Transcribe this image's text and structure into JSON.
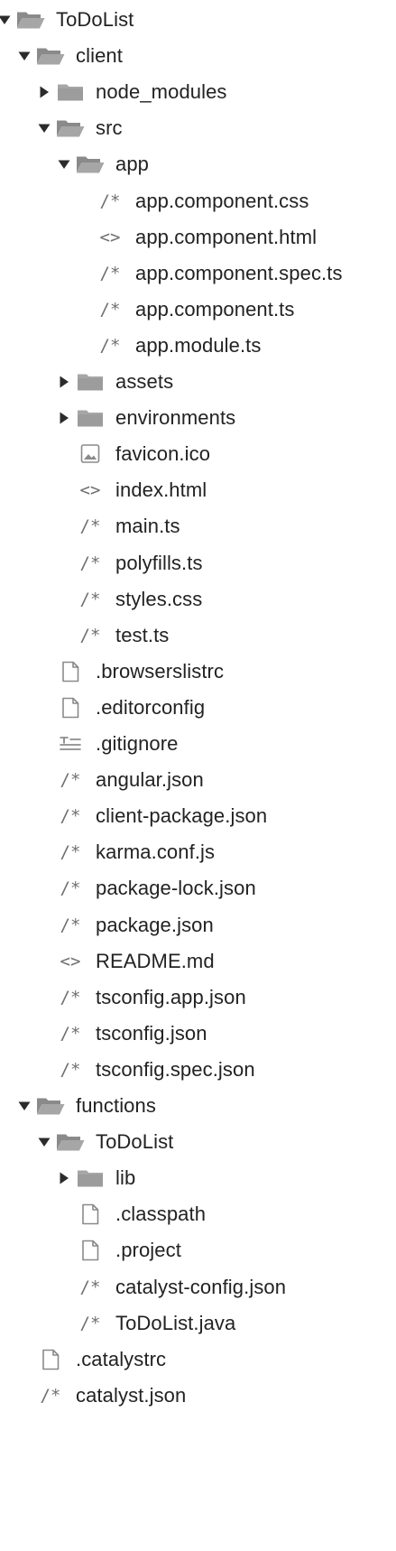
{
  "tree": {
    "glyphs": {
      "code": "<>",
      "comment": "/*"
    },
    "items": [
      {
        "label": "ToDoList",
        "icon": "folder-open-icon",
        "type": "folder",
        "expanded": true
      },
      {
        "label": "client",
        "icon": "folder-open-icon",
        "type": "folder",
        "expanded": true
      },
      {
        "label": "node_modules",
        "icon": "folder-icon",
        "type": "folder",
        "expanded": false
      },
      {
        "label": "src",
        "icon": "folder-open-icon",
        "type": "folder",
        "expanded": true
      },
      {
        "label": "app",
        "icon": "folder-open-icon",
        "type": "folder",
        "expanded": true
      },
      {
        "label": "app.component.css",
        "icon": "comment-code-icon",
        "type": "file"
      },
      {
        "label": "app.component.html",
        "icon": "markup-code-icon",
        "type": "file"
      },
      {
        "label": "app.component.spec.ts",
        "icon": "comment-code-icon",
        "type": "file"
      },
      {
        "label": "app.component.ts",
        "icon": "comment-code-icon",
        "type": "file"
      },
      {
        "label": "app.module.ts",
        "icon": "comment-code-icon",
        "type": "file"
      },
      {
        "label": "assets",
        "icon": "folder-icon",
        "type": "folder",
        "expanded": false
      },
      {
        "label": "environments",
        "icon": "folder-icon",
        "type": "folder",
        "expanded": false
      },
      {
        "label": "favicon.ico",
        "icon": "image-file-icon",
        "type": "file"
      },
      {
        "label": "index.html",
        "icon": "markup-code-icon",
        "type": "file"
      },
      {
        "label": "main.ts",
        "icon": "comment-code-icon",
        "type": "file"
      },
      {
        "label": "polyfills.ts",
        "icon": "comment-code-icon",
        "type": "file"
      },
      {
        "label": "styles.css",
        "icon": "comment-code-icon",
        "type": "file"
      },
      {
        "label": "test.ts",
        "icon": "comment-code-icon",
        "type": "file"
      },
      {
        "label": ".browserslistrc",
        "icon": "blank-file-icon",
        "type": "file"
      },
      {
        "label": ".editorconfig",
        "icon": "blank-file-icon",
        "type": "file"
      },
      {
        "label": ".gitignore",
        "icon": "text-lines-icon",
        "type": "file"
      },
      {
        "label": "angular.json",
        "icon": "comment-code-icon",
        "type": "file"
      },
      {
        "label": "client-package.json",
        "icon": "comment-code-icon",
        "type": "file"
      },
      {
        "label": "karma.conf.js",
        "icon": "comment-code-icon",
        "type": "file"
      },
      {
        "label": "package-lock.json",
        "icon": "comment-code-icon",
        "type": "file"
      },
      {
        "label": "package.json",
        "icon": "comment-code-icon",
        "type": "file"
      },
      {
        "label": "README.md",
        "icon": "markup-code-icon",
        "type": "file"
      },
      {
        "label": "tsconfig.app.json",
        "icon": "comment-code-icon",
        "type": "file"
      },
      {
        "label": "tsconfig.json",
        "icon": "comment-code-icon",
        "type": "file"
      },
      {
        "label": "tsconfig.spec.json",
        "icon": "comment-code-icon",
        "type": "file"
      },
      {
        "label": "functions",
        "icon": "folder-open-icon",
        "type": "folder",
        "expanded": true
      },
      {
        "label": "ToDoList",
        "icon": "folder-open-icon",
        "type": "folder",
        "expanded": true
      },
      {
        "label": "lib",
        "icon": "folder-icon",
        "type": "folder",
        "expanded": false
      },
      {
        "label": ".classpath",
        "icon": "blank-file-icon",
        "type": "file"
      },
      {
        "label": ".project",
        "icon": "blank-file-icon",
        "type": "file"
      },
      {
        "label": "catalyst-config.json",
        "icon": "comment-code-icon",
        "type": "file"
      },
      {
        "label": "ToDoList.java",
        "icon": "comment-code-icon",
        "type": "file"
      },
      {
        "label": ".catalystrc",
        "icon": "blank-file-icon",
        "type": "file"
      },
      {
        "label": "catalyst.json",
        "icon": "comment-code-icon",
        "type": "file"
      }
    ]
  }
}
